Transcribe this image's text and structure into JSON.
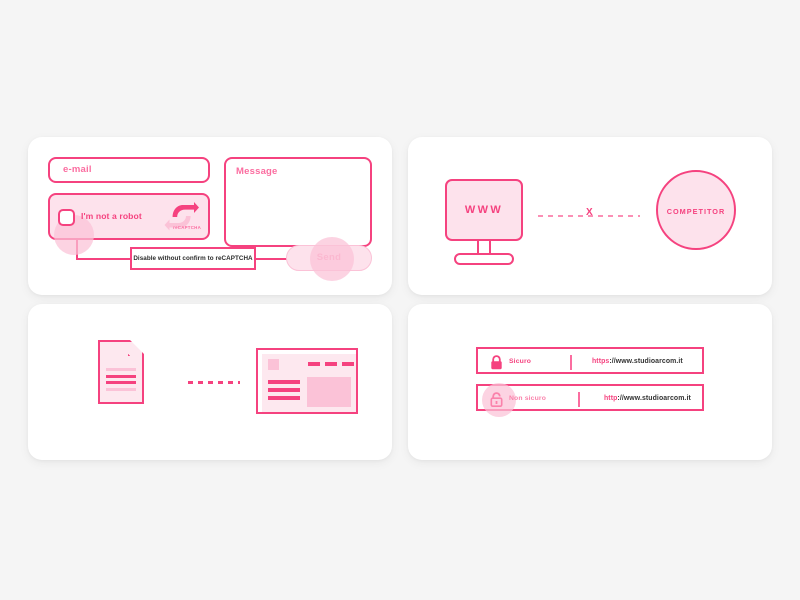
{
  "colors": {
    "background": "#f5f5f5",
    "card": "#ffffff",
    "accent": "#f5427f",
    "accent_light": "#fb6da0",
    "fill_light": "#fde2ec",
    "fill_mid": "#fbc2d7",
    "muted_pink": "#fa9dbf"
  },
  "cards": {
    "form": {
      "email": {
        "placeholder": "e-mail",
        "value": ""
      },
      "message": {
        "placeholder": "Message",
        "value": ""
      },
      "captcha": {
        "label": "I'm not a robot",
        "brand": "reCAPTCHA",
        "checked": false
      },
      "tooltip": "Disable without confirm to reCAPTCHA",
      "send_label": "Send"
    },
    "competitor": {
      "monitor_label": "WWW",
      "connector_marker": "X",
      "circle_label": "COMPETITOR"
    },
    "page": {
      "document_alt": "document-icon",
      "browser_alt": "browser-window-icon"
    },
    "security": {
      "rows": [
        {
          "icon": "lock-closed-icon",
          "status": "Sicuro",
          "scheme": "https",
          "url_rest": "://www.studioarcom.it",
          "highlighted": false
        },
        {
          "icon": "lock-open-icon",
          "status": "Non sicuro",
          "scheme": "http",
          "url_rest": "://www.studioarcom.it",
          "highlighted": true
        }
      ]
    }
  }
}
